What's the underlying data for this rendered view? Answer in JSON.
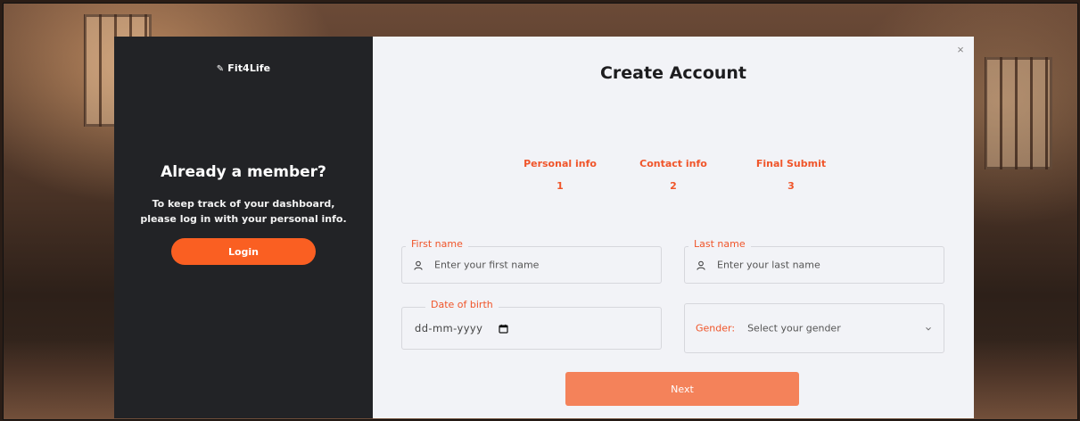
{
  "brand": {
    "icon": "pencil-icon",
    "name": "Fit4Life"
  },
  "left": {
    "title": "Already a member?",
    "text_line1": "To keep track of your dashboard,",
    "text_line2": "please log in with your personal info.",
    "login_label": "Login"
  },
  "modal": {
    "close_label": "×",
    "title": "Create Account"
  },
  "steps": [
    {
      "label": "Personal info",
      "number": "1"
    },
    {
      "label": "Contact info",
      "number": "2"
    },
    {
      "label": "Final Submit",
      "number": "3"
    }
  ],
  "form": {
    "first_name": {
      "label": "First name",
      "placeholder": "Enter your first name",
      "icon": "user-icon"
    },
    "last_name": {
      "label": "Last name",
      "placeholder": "Enter your last name",
      "icon": "user-icon"
    },
    "dob": {
      "label": "Date of birth",
      "placeholder": "dd-mm-yyyy",
      "icon": "calendar-icon"
    },
    "gender": {
      "label": "Gender:",
      "placeholder": "Select your gender",
      "icon": "chevron-down-icon"
    }
  },
  "next_label": "Next",
  "colors": {
    "accent": "#f0552a",
    "login_button": "#fa5f22",
    "next_button": "#f4825a",
    "dark_panel": "#222326",
    "form_bg": "#f2f3f7"
  }
}
